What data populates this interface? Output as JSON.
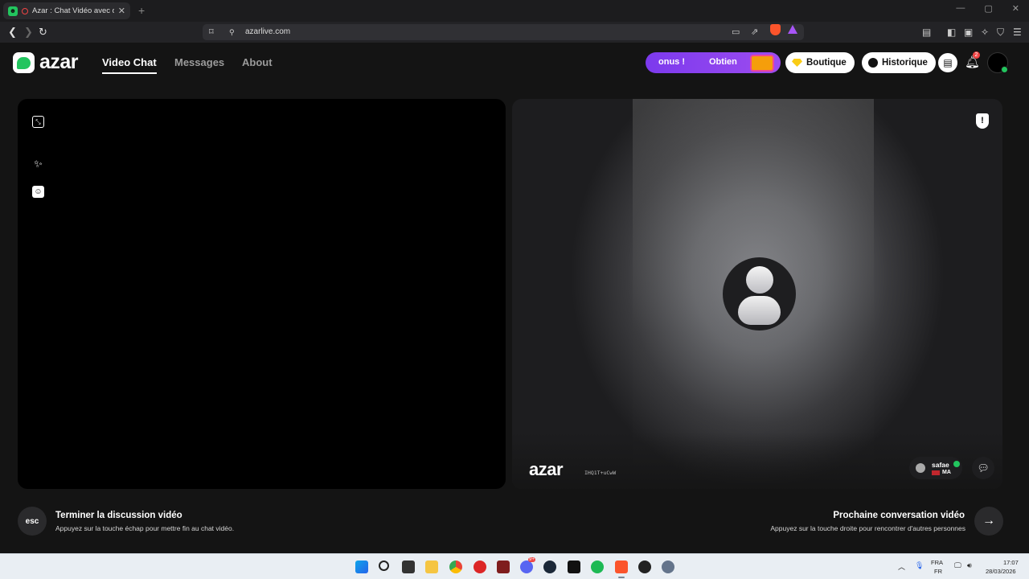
{
  "browser": {
    "tab_title": "Azar : Chat Vidéo avec de no",
    "url": "azarlive.com",
    "icons": [
      "back-icon",
      "forward-icon",
      "reload-icon",
      "bookmark-icon",
      "site-info-icon",
      "cast-icon",
      "share-icon",
      "brave-shield-icon",
      "brave-rewards-icon",
      "reader-icon",
      "sidebar-icon",
      "wallet-icon",
      "leo-ai-icon",
      "vpn-icon",
      "menu-icon"
    ]
  },
  "app": {
    "logo": "azar",
    "nav": [
      {
        "label": "Video Chat",
        "active": true
      },
      {
        "label": "Messages",
        "active": false
      },
      {
        "label": "About",
        "active": false
      }
    ],
    "promo": {
      "text_left": "onus !",
      "text_right": "Obtien"
    },
    "shop_label": "Boutique",
    "history_label": "Historique",
    "notifications_count": "2",
    "colors": {
      "accent": "#22c55e",
      "promo": "#7c3aed",
      "background": "#141414"
    }
  },
  "peer": {
    "watermark": "azar",
    "watermark_id": "IHQ1T+uCwW",
    "name": "safae",
    "country": "MA"
  },
  "actions": {
    "end_key": "esc",
    "end_title": "Terminer la discussion vidéo",
    "end_sub": "Appuyez sur la touche échap pour mettre fin au chat vidéo.",
    "next_title": "Prochaine conversation vidéo",
    "next_sub": "Appuyez sur la touche droite pour rencontrer d'autres personnes"
  },
  "taskbar": {
    "lang_top": "FRA",
    "lang_bottom": "FR",
    "time": "17:07",
    "date": "28/03/2026",
    "discord_badge": "9+"
  }
}
